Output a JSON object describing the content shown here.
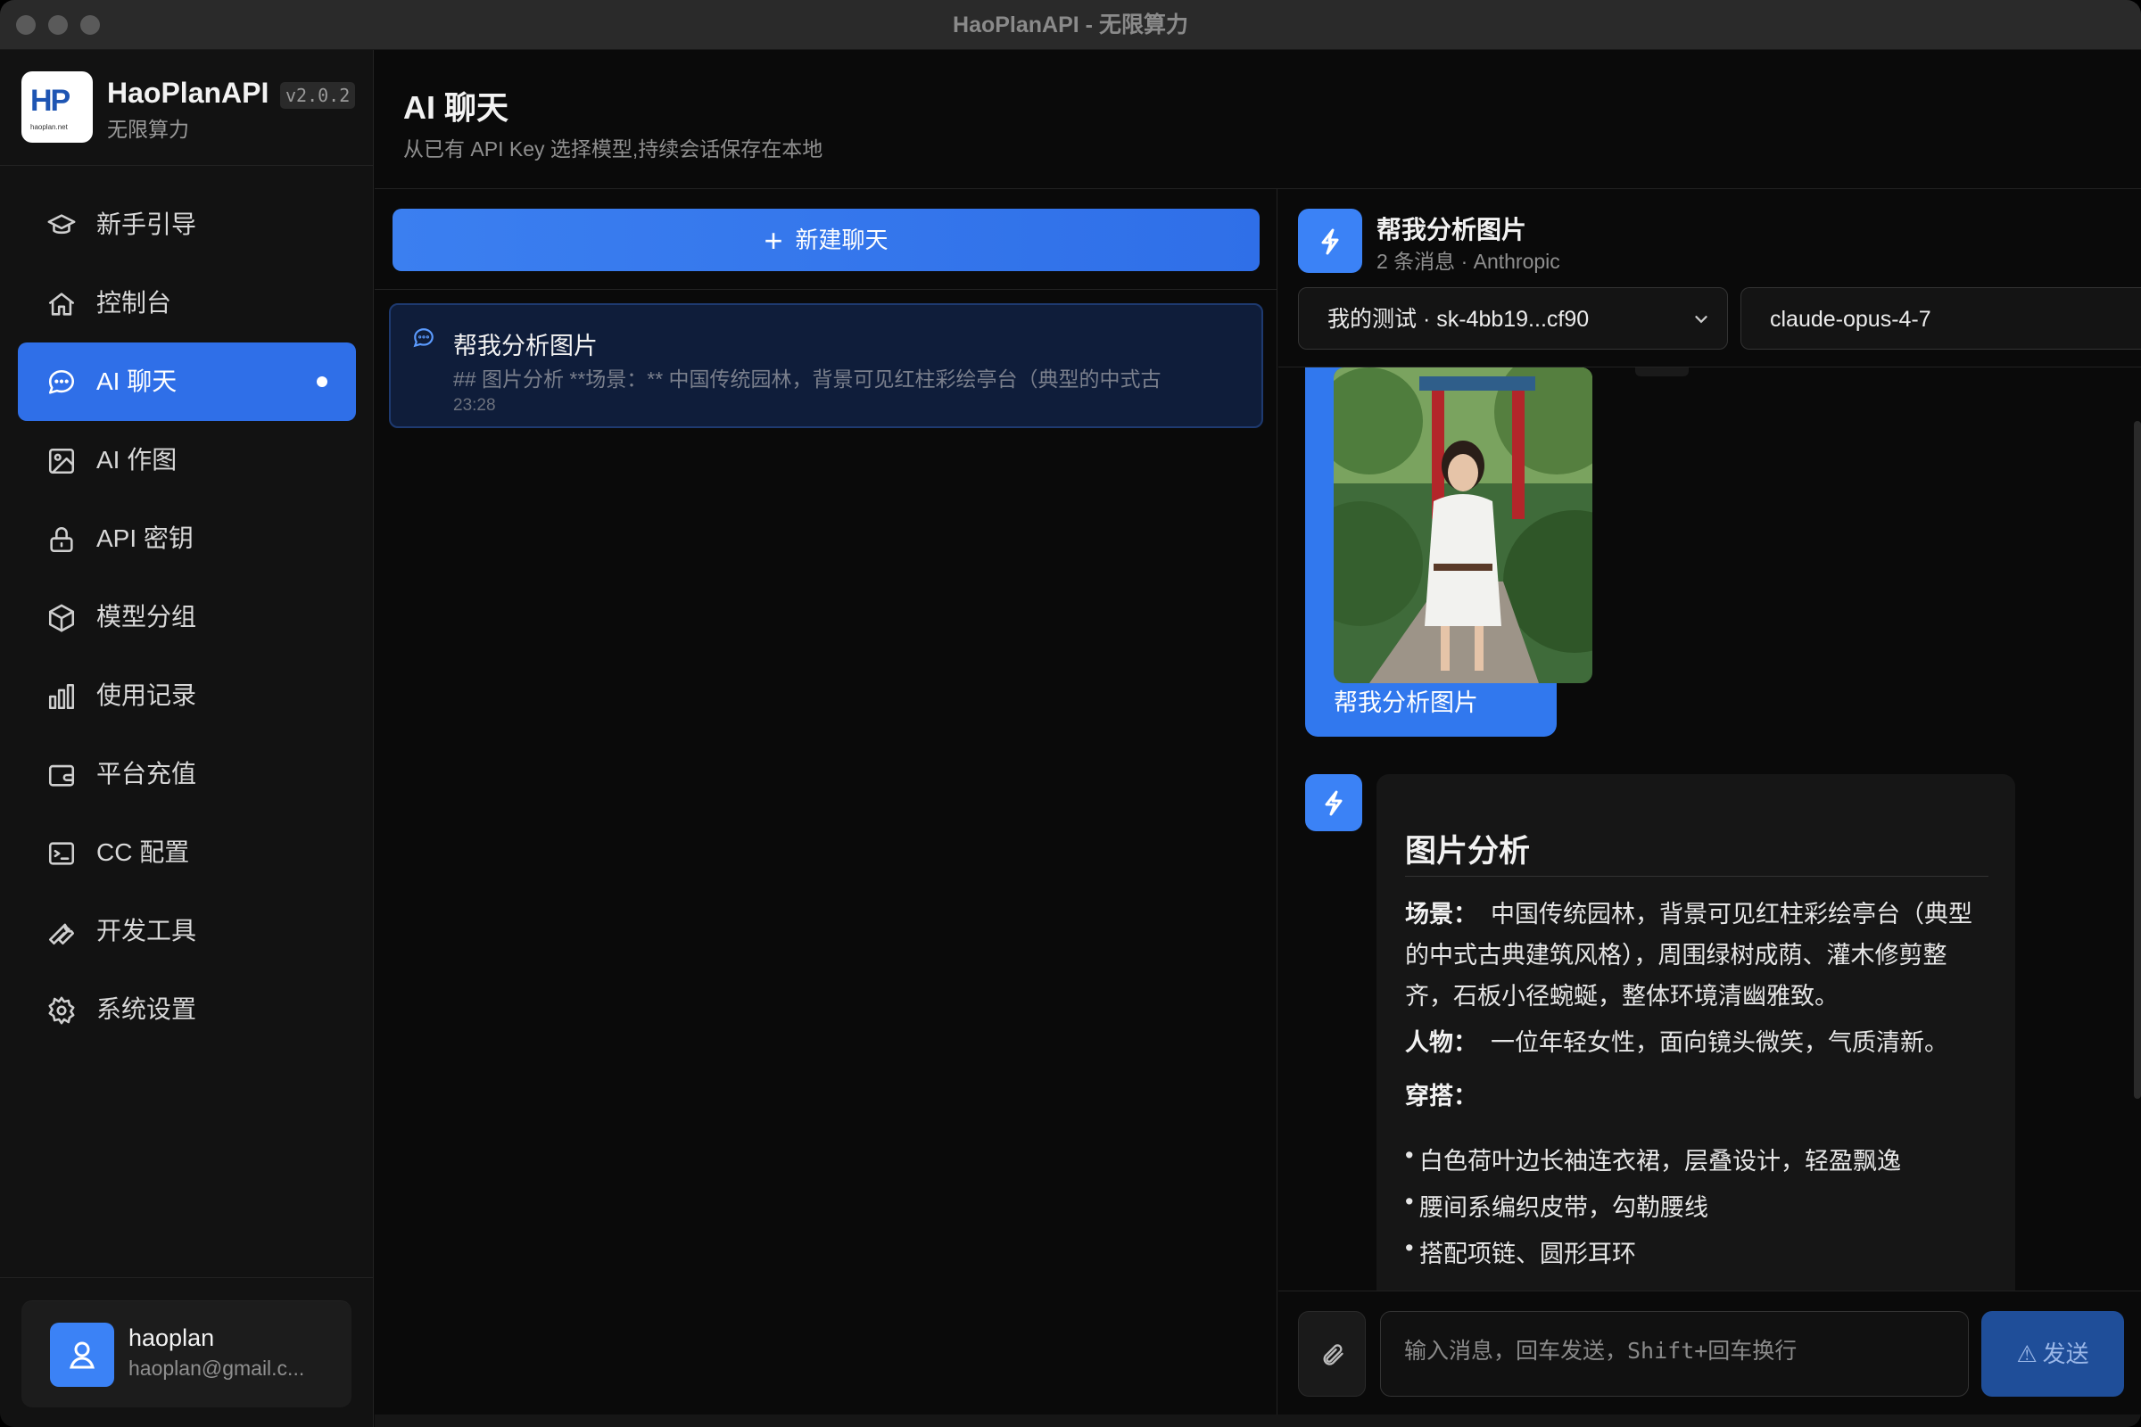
{
  "window": {
    "title": "HaoPlanAPI - 无限算力"
  },
  "brand": {
    "logo_text": "HP",
    "logo_url": "haoplan.net",
    "name": "HaoPlanAPI",
    "version": "v2.0.2",
    "tagline": "无限算力"
  },
  "nav": [
    {
      "label": "新手引导",
      "icon": "graduation-cap-icon"
    },
    {
      "label": "控制台",
      "icon": "home-icon"
    },
    {
      "label": "AI 聊天",
      "icon": "chat-bubble-icon",
      "active": true
    },
    {
      "label": "AI 作图",
      "icon": "image-icon"
    },
    {
      "label": "API 密钥",
      "icon": "lock-icon"
    },
    {
      "label": "模型分组",
      "icon": "cube-icon"
    },
    {
      "label": "使用记录",
      "icon": "bar-chart-icon"
    },
    {
      "label": "平台充值",
      "icon": "wallet-icon"
    },
    {
      "label": "CC 配置",
      "icon": "terminal-icon"
    },
    {
      "label": "开发工具",
      "icon": "wrench-icon"
    },
    {
      "label": "系统设置",
      "icon": "gear-icon"
    }
  ],
  "user": {
    "name": "haoplan",
    "email": "haoplan@gmail.c..."
  },
  "header": {
    "title": "AI 聊天",
    "subtitle": "从已有 API Key 选择模型,持续会话保存在本地"
  },
  "conversations": {
    "new_chat_label": "新建聊天",
    "items": [
      {
        "title": "帮我分析图片",
        "preview": "## 图片分析 **场景：** 中国传统园林，背景可见红柱彩绘亭台（典型的中式古",
        "time": "23:28"
      }
    ]
  },
  "chat": {
    "title": "帮我分析图片",
    "meta": "2 条消息 · Anthropic",
    "key_select": "我的测试 · sk-4bb19...cf90",
    "model_select": "claude-opus-4-7",
    "user_message": "帮我分析图片",
    "ai": {
      "heading": "图片分析",
      "scene_label": "场景：",
      "scene_text": "中国传统园林，背景可见红柱彩绘亭台（典型的中式古典建筑风格），周围绿树成荫、灌木修剪整齐，石板小径蜿蜒，整体环境清幽雅致。",
      "person_label": "人物：",
      "person_text": "一位年轻女性，面向镜头微笑，气质清新。",
      "outfit_label": "穿搭：",
      "outfit_items": [
        "白色荷叶边长袖连衣裙，层叠设计，轻盈飘逸",
        "腰间系编织皮带，勾勒腰线",
        "搭配项链、圆形耳环"
      ]
    },
    "input_placeholder": "输入消息，回车发送，Shift+回车换行",
    "send_label": "发送"
  },
  "colors": {
    "accent": "#2f6fe8",
    "background": "#0a0a0a",
    "sidebar": "#121212"
  }
}
